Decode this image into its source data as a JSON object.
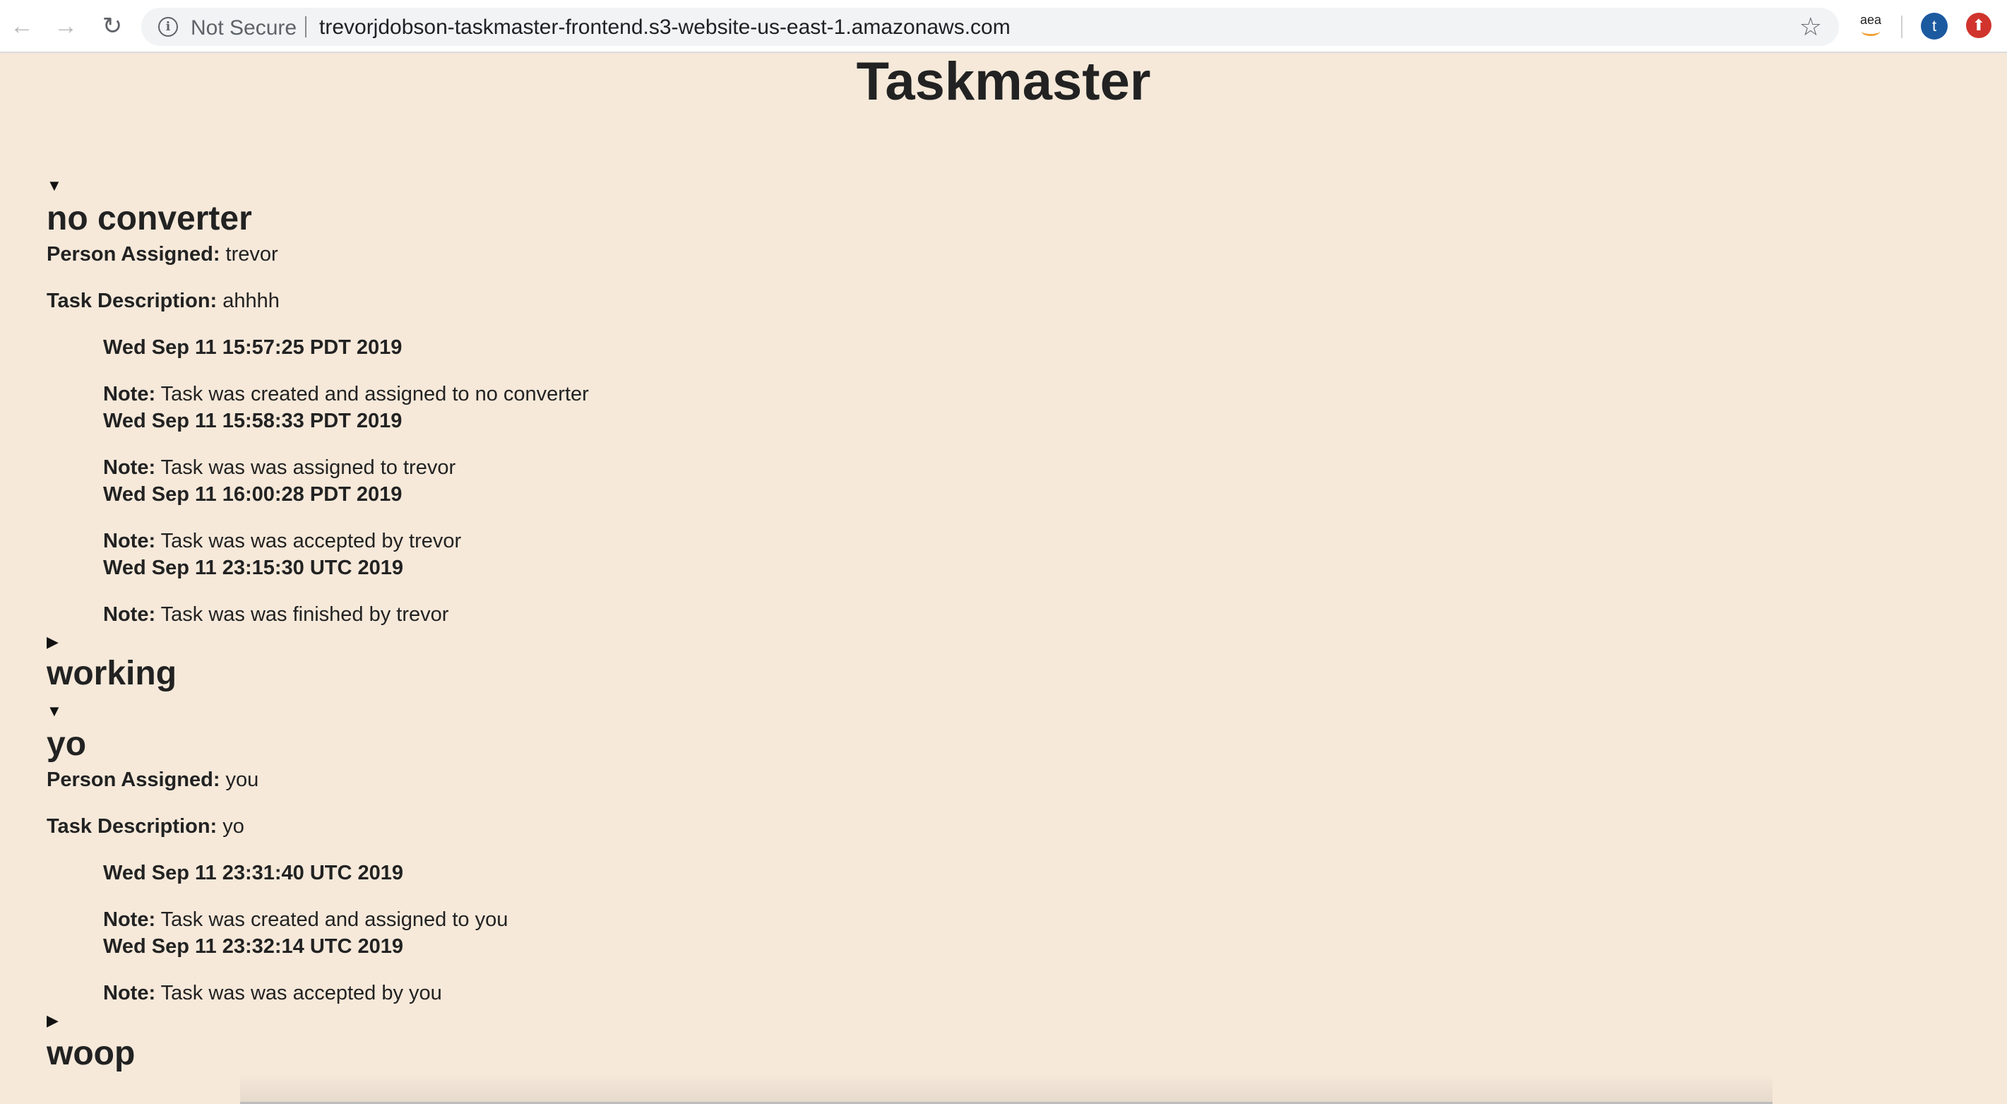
{
  "browser": {
    "security_label": "Not Secure",
    "url": "trevorjdobson-taskmaster-frontend.s3-website-us-east-1.amazonaws.com",
    "profile_initial": "t",
    "extension_label": "aea"
  },
  "page": {
    "title": "Taskmaster",
    "person_label": "Person Assigned:",
    "description_label": "Task Description:",
    "note_label": "Note:"
  },
  "tasks": [
    {
      "expanded": true,
      "name": "no converter",
      "person": "trevor",
      "description": "ahhhh",
      "history": [
        {
          "date": "Wed Sep 11 15:57:25 PDT 2019",
          "note": "Task was created and assigned to no converter"
        },
        {
          "date": "Wed Sep 11 15:58:33 PDT 2019",
          "note": "Task was was assigned to trevor"
        },
        {
          "date": "Wed Sep 11 16:00:28 PDT 2019",
          "note": "Task was was accepted by trevor"
        },
        {
          "date": "Wed Sep 11 23:15:30 UTC 2019",
          "note": "Task was was finished by trevor"
        }
      ]
    },
    {
      "expanded": false,
      "name": "working"
    },
    {
      "expanded": true,
      "name": "yo",
      "person": "you",
      "description": "yo",
      "history": [
        {
          "date": "Wed Sep 11 23:31:40 UTC 2019",
          "note": "Task was created and assigned to you"
        },
        {
          "date": "Wed Sep 11 23:32:14 UTC 2019",
          "note": "Task was was accepted by you"
        }
      ]
    },
    {
      "expanded": false,
      "name": "woop"
    }
  ]
}
